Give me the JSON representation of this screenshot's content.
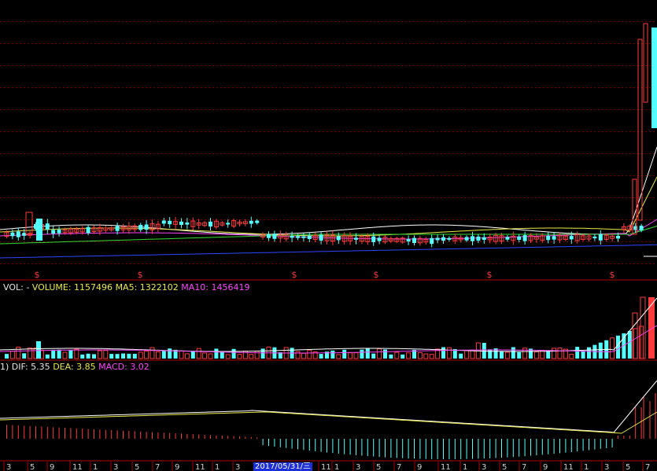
{
  "volume_panel": {
    "name": "VOL: -",
    "volume_label": "VOLUME: 1157496",
    "ma5_label": "MA5: 1322102",
    "ma10_label": "MA10: 1456419"
  },
  "macd_panel": {
    "prefix": "1)",
    "dif_label": "DIF: 5.35",
    "dea_label": "DEA: 3.85",
    "macd_label": "MACD: 3.02"
  },
  "cursor_date": "2017/05/31/三",
  "x_axis_ticks": [
    "3",
    "5",
    "9",
    "11",
    "1",
    "3",
    "5",
    "7",
    "9",
    "11",
    "1",
    "3",
    "11",
    "1",
    "3",
    "5",
    "7",
    "9",
    "11",
    "1",
    "3",
    "5",
    "7",
    "9",
    "11",
    "1",
    "3",
    "5",
    "7"
  ],
  "event_markers": [
    "$",
    "$",
    "$",
    "$",
    "$",
    "$"
  ],
  "colors": {
    "up": "#ff3b3b",
    "down": "#54ffff",
    "grid": "#7a0000",
    "ma_white": "#ffffff",
    "ma_yellow": "#e8e84a",
    "ma_magenta": "#ff44ff",
    "ma_green": "#33dd33",
    "ma_blue": "#3344ff"
  }
}
